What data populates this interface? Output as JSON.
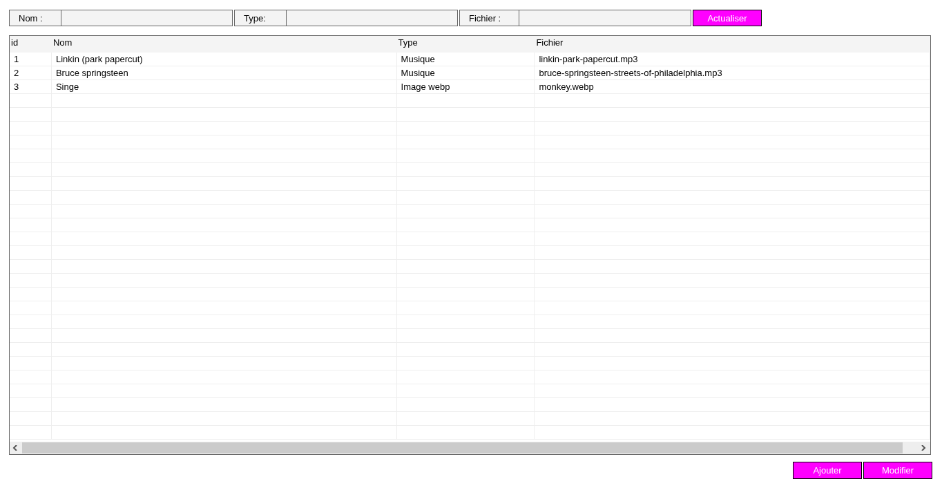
{
  "filters": [
    {
      "label": "Nom :"
    },
    {
      "label": "Type:"
    },
    {
      "label": "Fichier :"
    }
  ],
  "refresh_button": "Actualiser",
  "table": {
    "columns": [
      "id",
      "Nom",
      "Type",
      "Fichier"
    ],
    "rows": [
      [
        "1",
        "Linkin (park papercut)",
        "Musique",
        "linkin-park-papercut.mp3"
      ],
      [
        "2",
        "Bruce springsteen",
        "Musique",
        "bruce-springsteen-streets-of-philadelphia.mp3"
      ],
      [
        "3",
        "Singe",
        "Image webp",
        "monkey.webp"
      ]
    ]
  },
  "buttons": [
    "Ajouter",
    "Modifier"
  ]
}
